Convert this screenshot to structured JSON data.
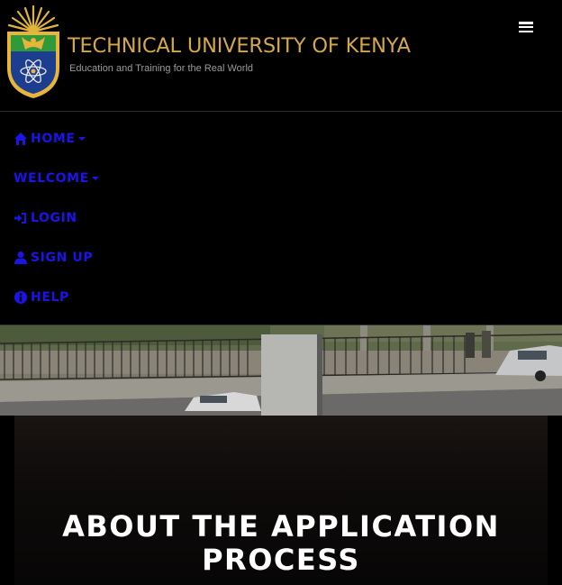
{
  "header": {
    "brand_title": "TECHNICAL UNIVERSITY OF KENYA",
    "tagline": "Education and Training for the Real World",
    "menu_icon": "hamburger-menu-icon"
  },
  "nav": {
    "items": [
      {
        "label": "HOME",
        "icon": "home-icon",
        "dropdown": true
      },
      {
        "label": "WELCOME",
        "icon": "",
        "dropdown": true
      },
      {
        "label": "LOGIN",
        "icon": "sign-in-icon",
        "dropdown": false
      },
      {
        "label": "SIGN UP",
        "icon": "user-icon",
        "dropdown": false
      },
      {
        "label": "HELP",
        "icon": "info-circle-icon",
        "dropdown": false
      }
    ]
  },
  "main": {
    "title_line1": "ABOUT THE APPLICATION",
    "title_line2": "PROCESS"
  },
  "colors": {
    "nav_link": "#1c14e6",
    "brand_gold": "#d4a74a",
    "background": "#000000"
  }
}
